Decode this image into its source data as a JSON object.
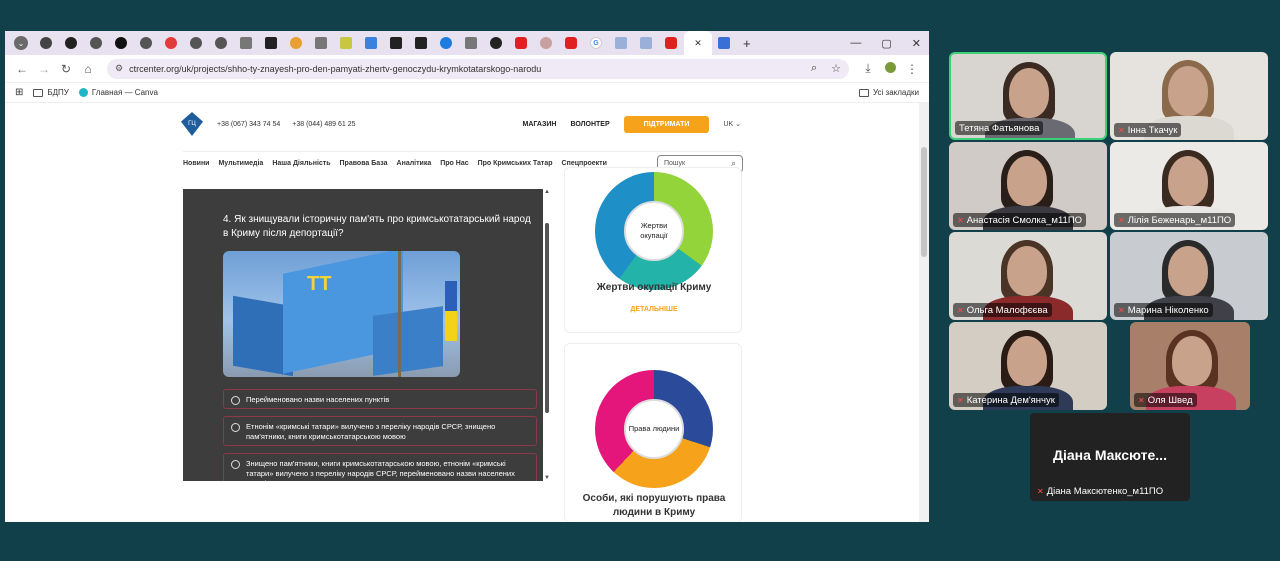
{
  "browser": {
    "url": "ctrcenter.org/uk/projects/shho-ty-znayesh-pro-den-pamyati-zhertv-genoczydu-krymkotatarskogo-narodu",
    "tab_icons": [
      "chrome",
      "github",
      "chrome",
      "notion",
      "chrome",
      "red-c",
      "chrome",
      "chrome",
      "pkp",
      "k",
      "star",
      "pkp",
      "m",
      "doc",
      "k",
      "k",
      "c",
      "pkp",
      "spotify",
      "youtube",
      "pinky",
      "youtube",
      "google",
      "nvs",
      "nvs",
      "youtube",
      "active"
    ],
    "win_controls": {
      "minimize": "—",
      "maximize": "▢",
      "close": "✕",
      "new_tab": "+",
      "tab_close": "✕",
      "dropdown": "⌄"
    },
    "bookmarks": [
      {
        "label": "БДПУ",
        "icon": "folder"
      },
      {
        "label": "Главная — Canva",
        "icon": "canva"
      }
    ],
    "bookmarks_right": "Усі закладки"
  },
  "site": {
    "phone1": "+38 (067) 343 74 54",
    "phone2": "+38 (044) 489 61 25",
    "shop": "МАГАЗИН",
    "volunteer": "ВОЛОНТЕР",
    "support": "ПІДТРИМАТИ",
    "lang": "UK",
    "nav": [
      "Новини",
      "Мультимедіа",
      "Наша Діяльність",
      "Правова База",
      "Аналітика",
      "Про Нас",
      "Про Кримських Татар",
      "Спецпроекти"
    ],
    "search_placeholder": "Пошук"
  },
  "quiz": {
    "question": "4. Як знищували історичну пам'ять про кримськотатарський народ в Криму після депортації?",
    "options": [
      "Перейменовано назви населених пунктів",
      "Етнонім «кримські татари» вилучено з переліку народів СРСР, знищено пам'ятники, книги кримськотатарською мовою",
      "Знищено пам'ятники, книги кримськотатарською мовою, етнонім «кримські татари» вилучено з переліку народів СРСР, перейменовано назви населених пунктів"
    ]
  },
  "cards": [
    {
      "center": "Жертви окупації",
      "title": "Жертви окупації Криму",
      "link": "ДЕТАЛЬНІШЕ"
    },
    {
      "center": "Права людини",
      "title": "Особи, які порушують права людини в Криму"
    }
  ],
  "call": {
    "participants": [
      {
        "name": "Тетяна Фатьянова",
        "muted": false,
        "active": true
      },
      {
        "name": "Інна Ткачук",
        "muted": true,
        "active": false
      },
      {
        "name": "Анастасія Смолка_м11ПО",
        "muted": true,
        "active": false
      },
      {
        "name": "Лілія Беженарь_м11ПО",
        "muted": true,
        "active": false
      },
      {
        "name": "Ольга Малофєєва",
        "muted": true,
        "active": false
      },
      {
        "name": "Марина Ніколенко",
        "muted": true,
        "active": false
      },
      {
        "name": "Катерина Дем'янчук",
        "muted": true,
        "active": false
      },
      {
        "name": "Оля Швед",
        "muted": true,
        "active": false
      }
    ],
    "name_only": {
      "display": "Діана Максюте...",
      "name": "Діана Максютенко_м11ПО",
      "muted": true
    }
  }
}
